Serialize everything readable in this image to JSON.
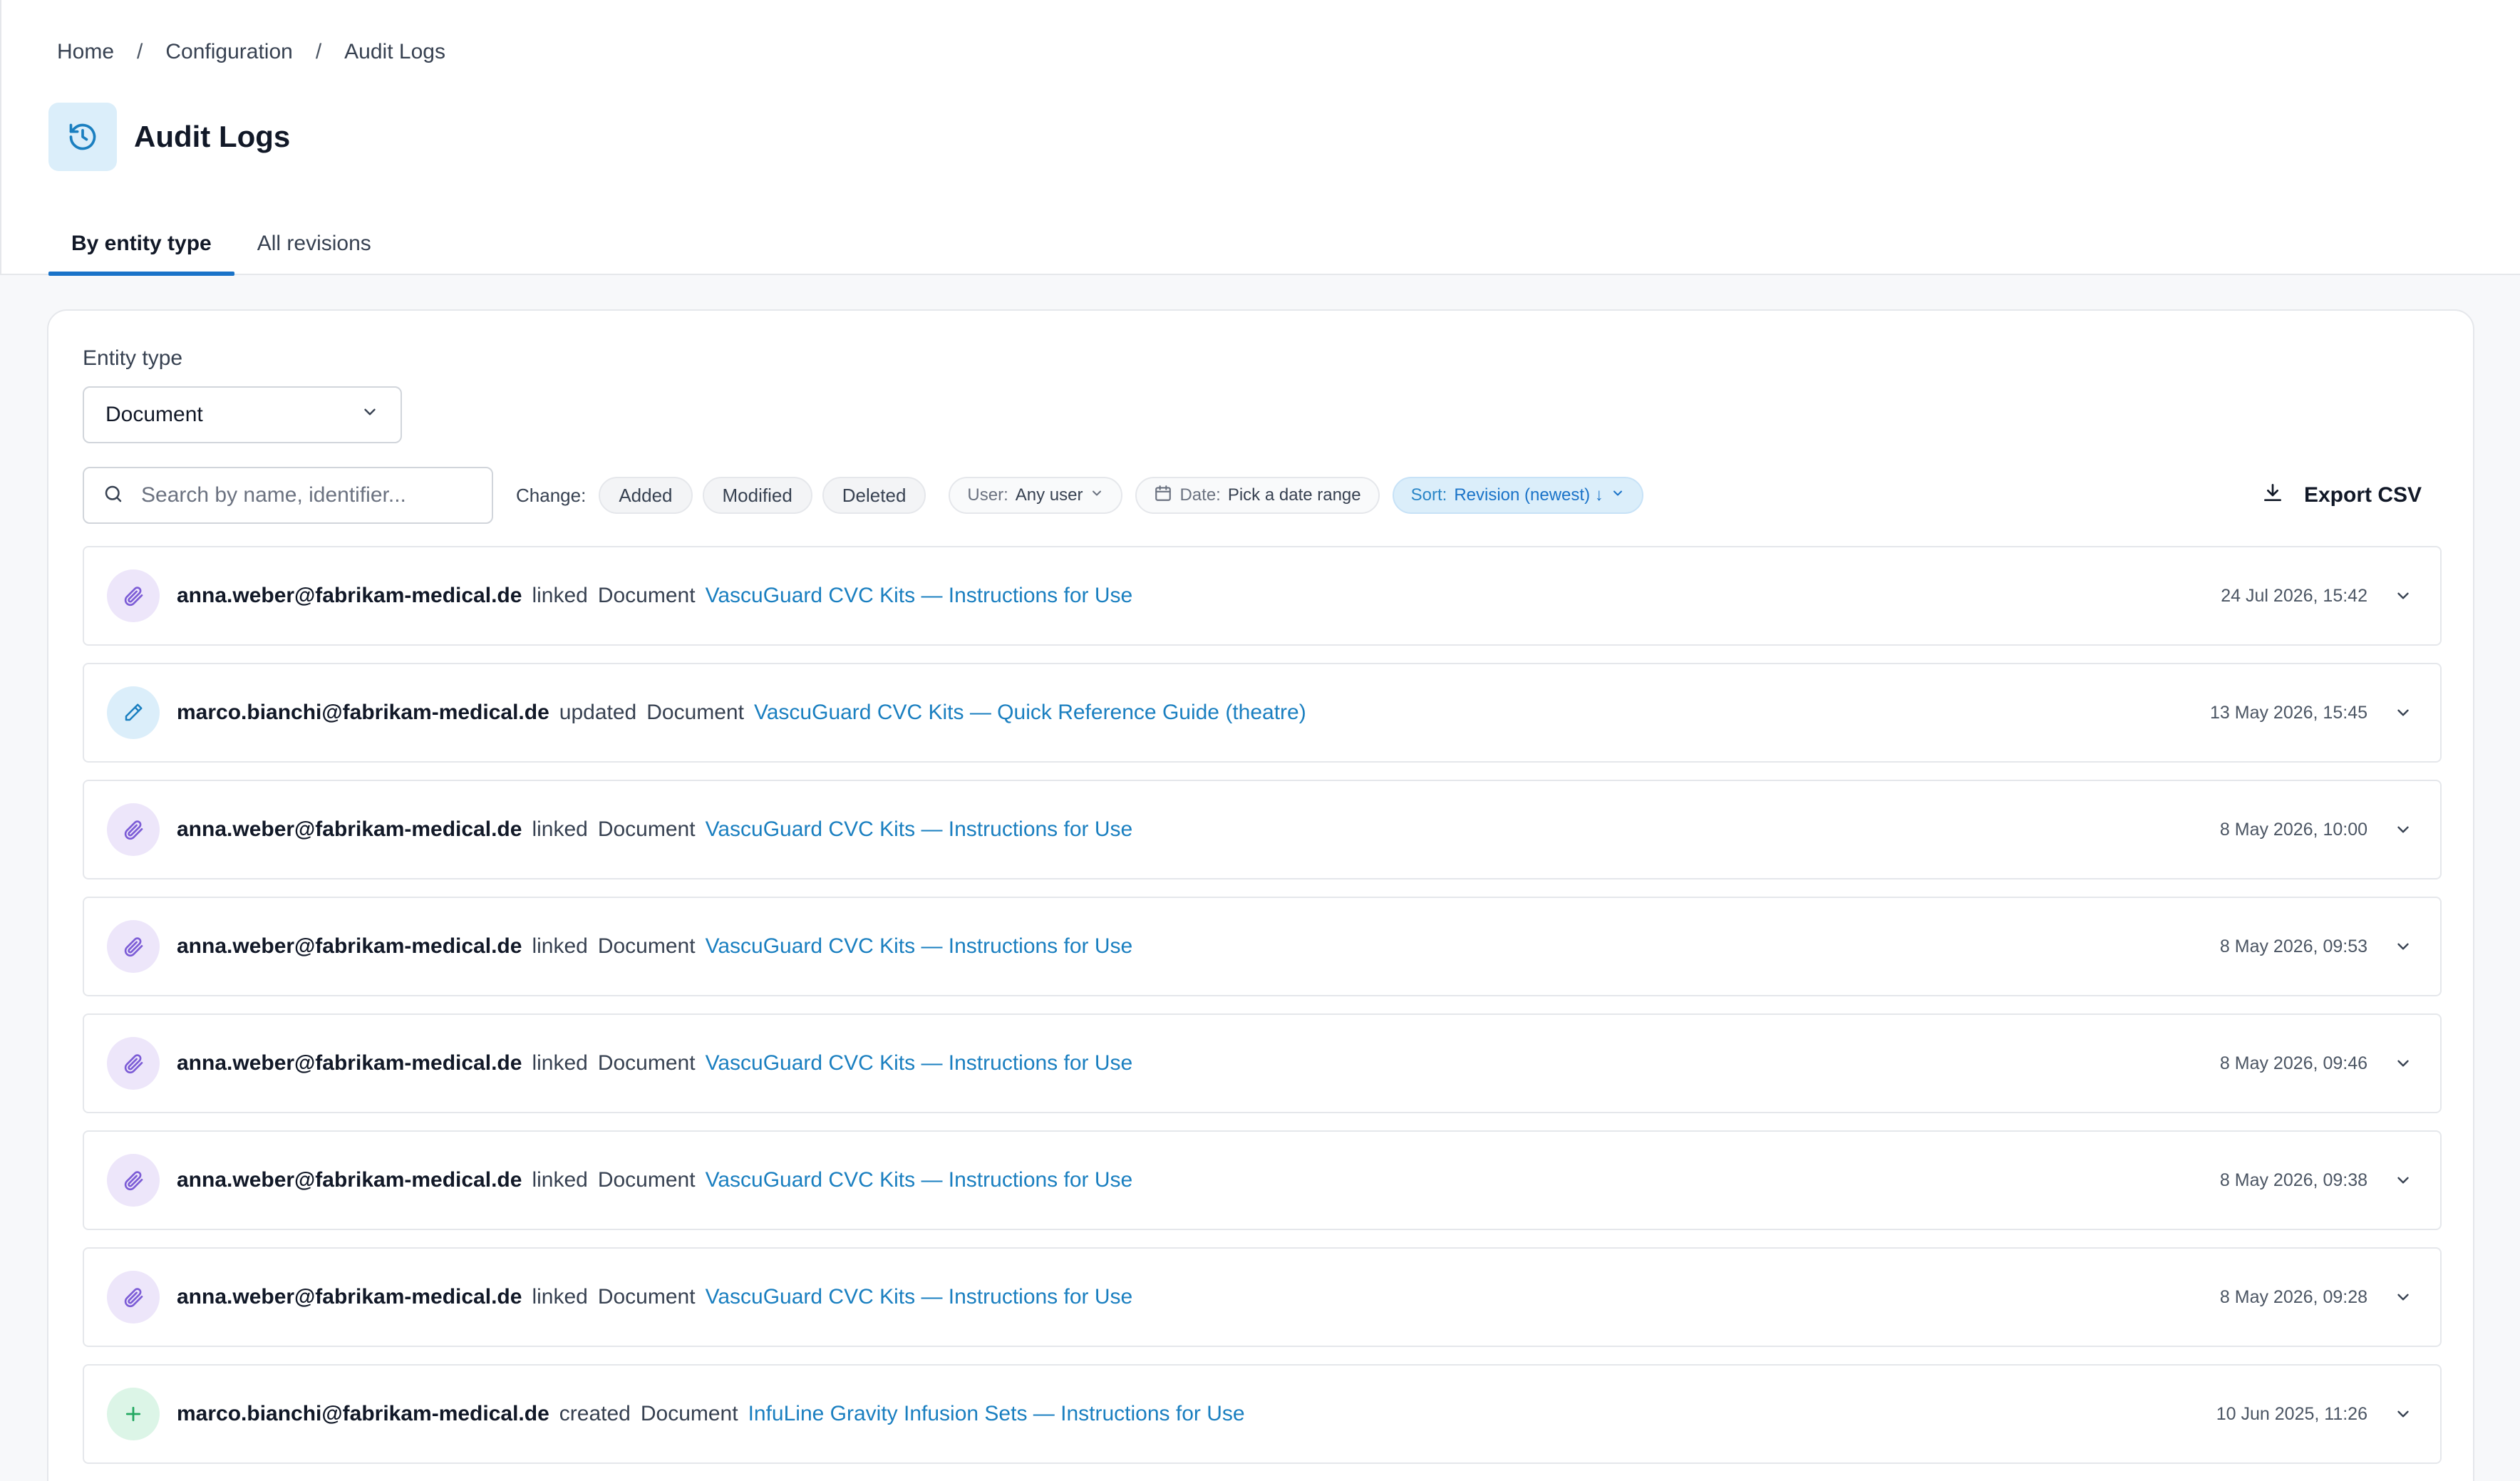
{
  "breadcrumb": [
    "Home",
    "Configuration",
    "Audit Logs"
  ],
  "page": {
    "title": "Audit Logs",
    "icon": "history-icon"
  },
  "tabs": [
    {
      "label": "By entity type",
      "active": true
    },
    {
      "label": "All revisions",
      "active": false
    }
  ],
  "filters": {
    "entity_type_label": "Entity type",
    "entity_type_value": "Document",
    "search_placeholder": "Search by name, identifier...",
    "change_label": "Change:",
    "change_options": [
      "Added",
      "Modified",
      "Deleted"
    ],
    "user_label": "User:",
    "user_value": "Any user",
    "date_label": "Date:",
    "date_value": "Pick a date range",
    "sort_label": "Sort:",
    "sort_value": "Revision (newest) ↓",
    "export_label": "Export CSV"
  },
  "colors": {
    "accent": "#1a73c8",
    "link": "#1a7fc0",
    "linked_icon": "#7c5cd6",
    "updated_icon": "#1a7fc0",
    "created_icon": "#22a861"
  },
  "rows": [
    {
      "kind": "linked",
      "icon": "paperclip-icon",
      "user": "anna.weber@fabrikam-medical.de",
      "action": "linked",
      "entity_type": "Document",
      "entity": "VascuGuard CVC Kits — Instructions for Use",
      "timestamp": "24 Jul 2026, 15:42"
    },
    {
      "kind": "updated",
      "icon": "pencil-icon",
      "user": "marco.bianchi@fabrikam-medical.de",
      "action": "updated",
      "entity_type": "Document",
      "entity": "VascuGuard CVC Kits — Quick Reference Guide (theatre)",
      "timestamp": "13 May 2026, 15:45"
    },
    {
      "kind": "linked",
      "icon": "paperclip-icon",
      "user": "anna.weber@fabrikam-medical.de",
      "action": "linked",
      "entity_type": "Document",
      "entity": "VascuGuard CVC Kits — Instructions for Use",
      "timestamp": "8 May 2026, 10:00"
    },
    {
      "kind": "linked",
      "icon": "paperclip-icon",
      "user": "anna.weber@fabrikam-medical.de",
      "action": "linked",
      "entity_type": "Document",
      "entity": "VascuGuard CVC Kits — Instructions for Use",
      "timestamp": "8 May 2026, 09:53"
    },
    {
      "kind": "linked",
      "icon": "paperclip-icon",
      "user": "anna.weber@fabrikam-medical.de",
      "action": "linked",
      "entity_type": "Document",
      "entity": "VascuGuard CVC Kits — Instructions for Use",
      "timestamp": "8 May 2026, 09:46"
    },
    {
      "kind": "linked",
      "icon": "paperclip-icon",
      "user": "anna.weber@fabrikam-medical.de",
      "action": "linked",
      "entity_type": "Document",
      "entity": "VascuGuard CVC Kits — Instructions for Use",
      "timestamp": "8 May 2026, 09:38"
    },
    {
      "kind": "linked",
      "icon": "paperclip-icon",
      "user": "anna.weber@fabrikam-medical.de",
      "action": "linked",
      "entity_type": "Document",
      "entity": "VascuGuard CVC Kits — Instructions for Use",
      "timestamp": "8 May 2026, 09:28"
    },
    {
      "kind": "created",
      "icon": "plus-icon",
      "user": "marco.bianchi@fabrikam-medical.de",
      "action": "created",
      "entity_type": "Document",
      "entity": "InfuLine Gravity Infusion Sets — Instructions for Use",
      "timestamp": "10 Jun 2025, 11:26"
    }
  ]
}
